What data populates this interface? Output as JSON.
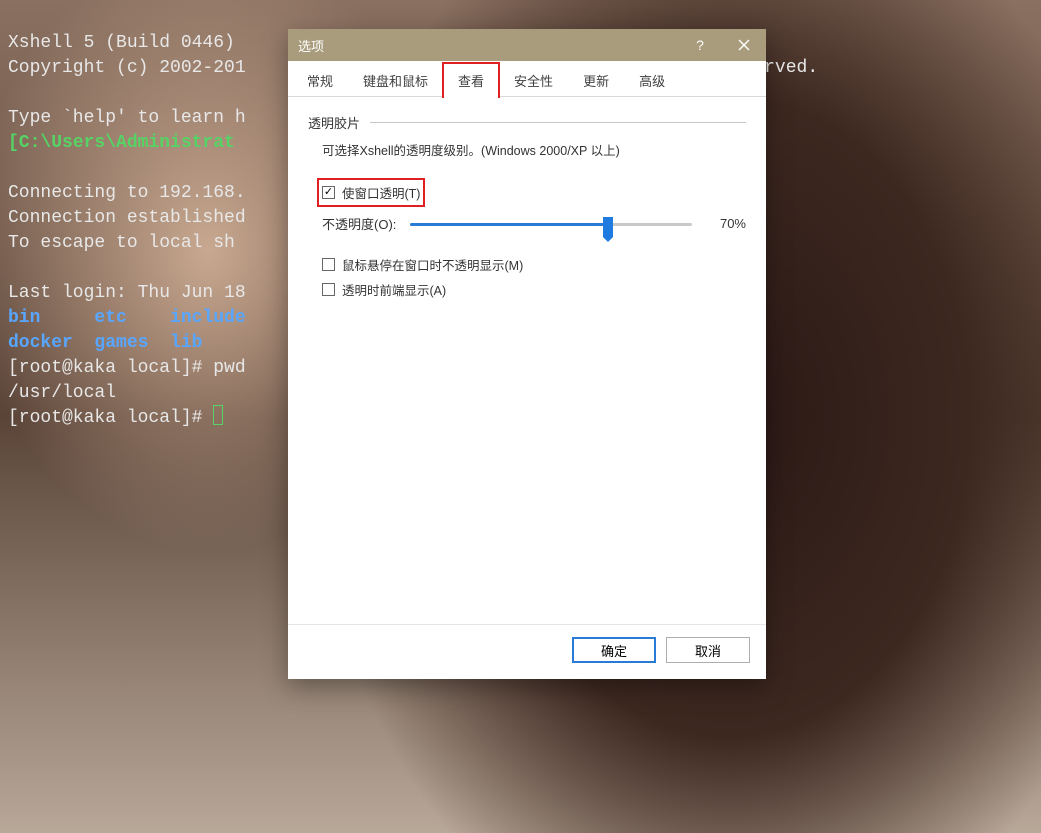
{
  "terminal": {
    "line1": "Xshell 5 (Build 0446)",
    "line2_pre": "Copyright (c) 2002-201",
    "line2_post": " reserved.",
    "help": "Type `help' to learn h",
    "prompt_path": "[C:\\Users\\Administrat",
    "connect1": "Connecting to 192.168.",
    "connect2": "Connection established",
    "connect3": "To escape to local sh",
    "lastlogin": "Last login: Thu Jun 18",
    "dirs_row1_a": "bin",
    "dirs_row1_b": "etc",
    "dirs_row1_c": "include",
    "dirs_row2_a": "docker",
    "dirs_row2_b": "games",
    "dirs_row2_c": "lib",
    "shell1_prompt": "[root@kaka local]# ",
    "shell1_cmd": "pwd",
    "pwd_out": "/usr/local",
    "shell2_prompt": "[root@kaka local]# "
  },
  "dialog": {
    "title": "选项",
    "tabs": {
      "general": "常规",
      "keyboard": "键盘和鼠标",
      "view": "查看",
      "security": "安全性",
      "update": "更新",
      "advanced": "高级"
    },
    "section_title": "透明胶片",
    "desc": "可选择Xshell的透明度级别。(Windows 2000/XP 以上)",
    "cb_transparent": "使窗口透明(T)",
    "opacity_label": "不透明度(O):",
    "opacity_value": "70%",
    "opacity_percent": 70,
    "cb_hover": "鼠标悬停在窗口时不透明显示(M)",
    "cb_topmost": "透明时前端显示(A)",
    "btn_ok": "确定",
    "btn_cancel": "取消"
  }
}
